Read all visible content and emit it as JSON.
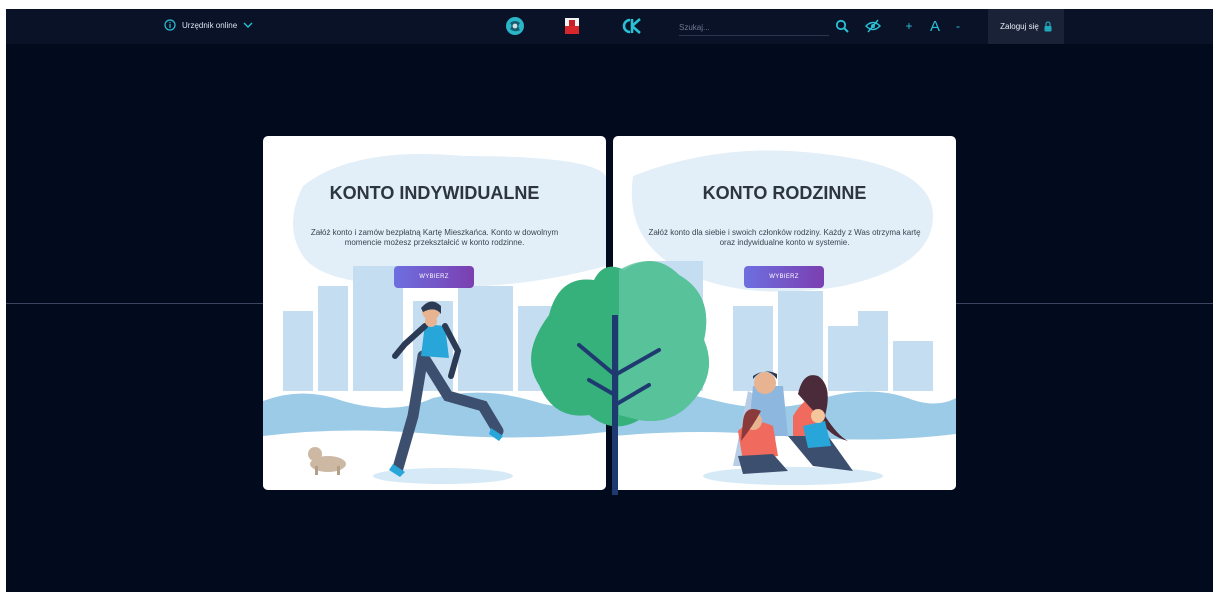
{
  "header": {
    "official_label": "Urzędnik online",
    "search_placeholder": "Szukaj...",
    "font_increase": "+",
    "font_label": "A",
    "font_decrease": "-",
    "login_label": "Zaloguj się"
  },
  "icons": {
    "official": "info-circle-icon",
    "official_arrow": "chevron-down-icon",
    "logo_round": "city-round-logo-icon",
    "logo_flag": "coat-of-arms-flag-icon",
    "logo_ck": "ck-logo-icon",
    "search": "search-icon",
    "contrast": "eye-slash-icon",
    "login": "lock-icon"
  },
  "colors": {
    "page_background": "#020b1e",
    "accent": "#2ac0d6",
    "button_gradient_start": "#6e6fe0",
    "button_gradient_end": "#7b3fb0"
  },
  "cards": [
    {
      "title": "KONTO INDYWIDUALNE",
      "description": "Załóż konto i zamów bezpłatną Kartę Mieszkańca. Konto w dowolnym momencie możesz przekształcić w konto rodzinne.",
      "button_label": "WYBIERZ"
    },
    {
      "title": "KONTO RODZINNE",
      "description": "Załóż konto dla siebie i swoich członków rodziny. Każdy z Was otrzyma kartę oraz indywidualne konto w systemie.",
      "button_label": "WYBIERZ"
    }
  ]
}
